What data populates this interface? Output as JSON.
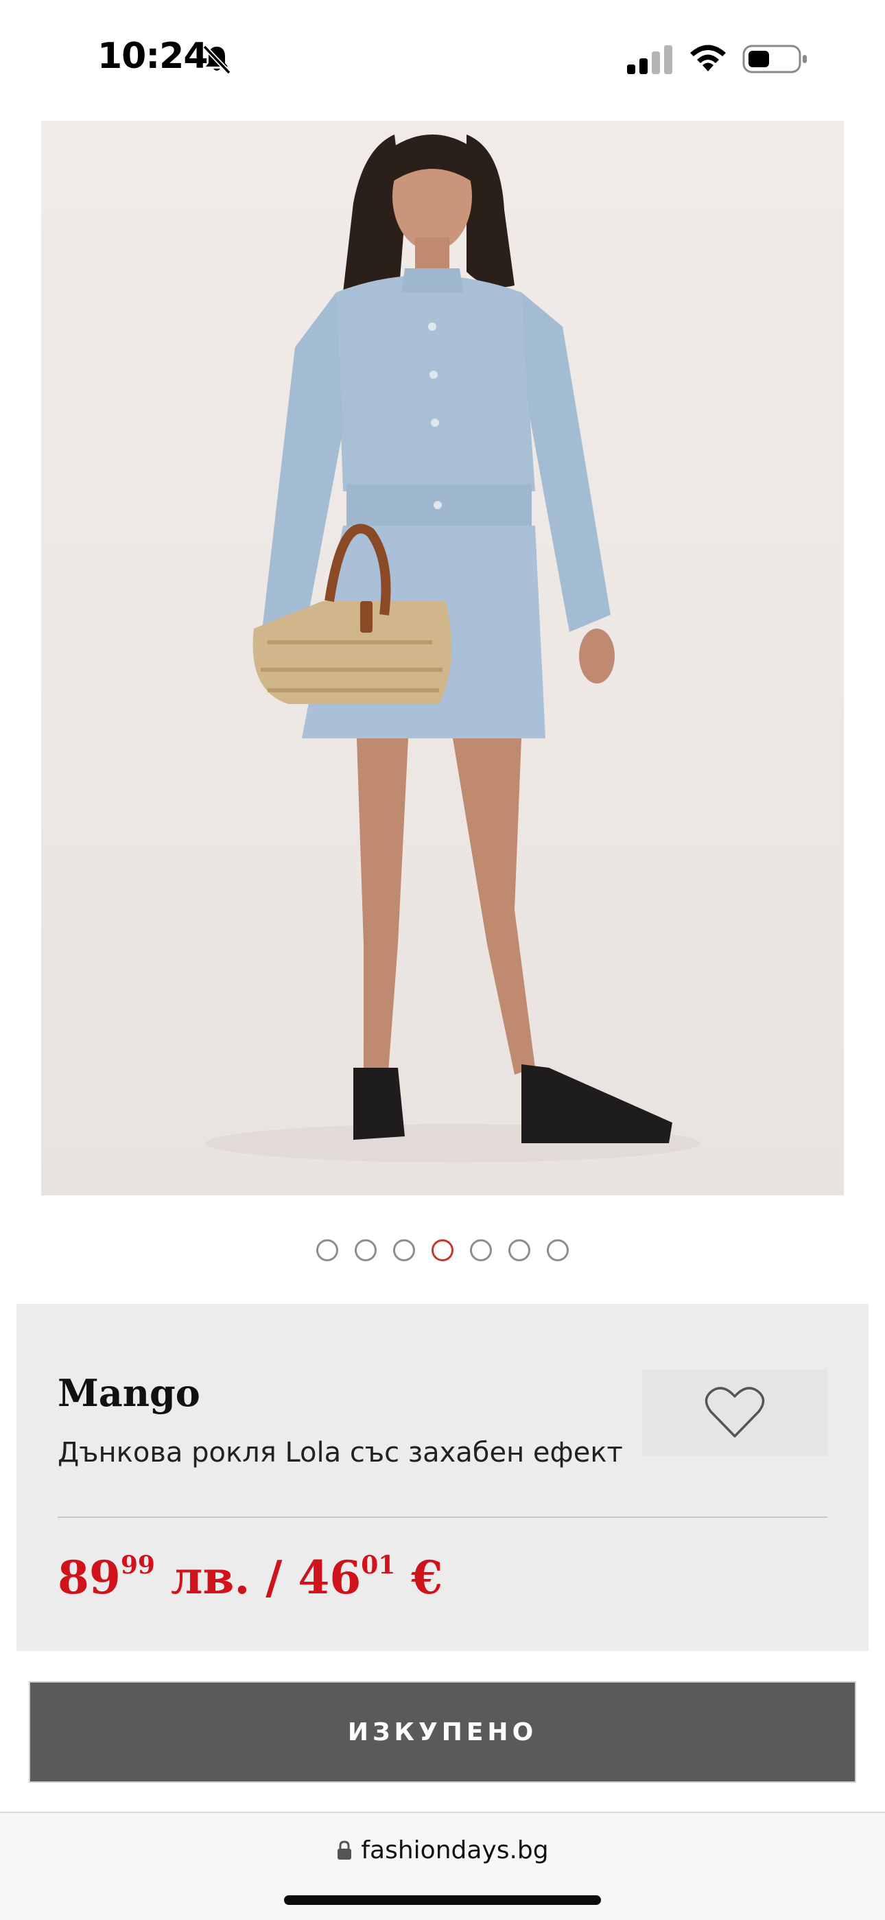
{
  "status_bar": {
    "time": "10:24",
    "icons": [
      "bell-slash-icon",
      "cellular-signal-icon",
      "wifi-icon",
      "battery-icon"
    ]
  },
  "product_image": {
    "description_icon": "product-photo"
  },
  "carousel": {
    "total": 7,
    "active_index": 3
  },
  "product": {
    "brand": "Mango",
    "title": "Дънкова рокля Lola със захабен ефект",
    "price_bgn_main": "89",
    "price_bgn_cents": "99",
    "price_bgn_unit": " лв. / ",
    "price_eur_main": "46",
    "price_eur_cents": "01",
    "price_eur_unit": " €",
    "wishlist_icon": "heart-icon"
  },
  "actions": {
    "sold_out_label": "ИЗКУПЕНО"
  },
  "browser": {
    "url": "fashiondays.bg"
  },
  "colors": {
    "price_red": "#d0121b",
    "active_dot": "#c8352a",
    "button_gray": "#5a5a5a",
    "card_bg": "#ececed"
  }
}
